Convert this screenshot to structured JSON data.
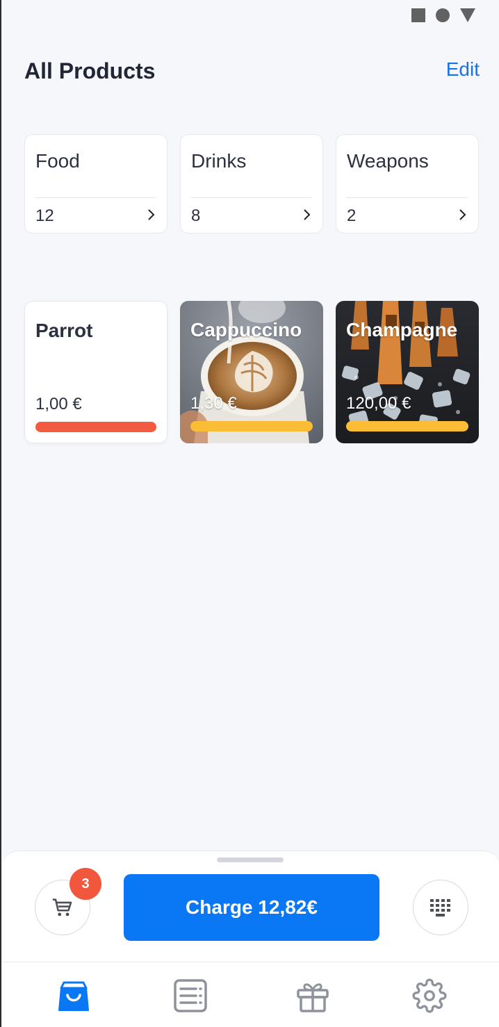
{
  "status_bar": {
    "icons": [
      "square-icon",
      "circle-icon",
      "triangle-icon"
    ]
  },
  "header": {
    "title": "All Products",
    "edit_label": "Edit"
  },
  "categories": [
    {
      "name": "Food",
      "count": "12"
    },
    {
      "name": "Drinks",
      "count": "8"
    },
    {
      "name": "Weapons",
      "count": "2"
    }
  ],
  "products": [
    {
      "name": "Parrot",
      "price": "1,00 €",
      "bar_color": "#f25b3f",
      "image": "none"
    },
    {
      "name": "Cappuccino",
      "price": "1,30 €",
      "bar_color": "#fbbd36",
      "image": "latte-art-photo"
    },
    {
      "name": "Champagne",
      "price": "120,00 €",
      "bar_color": "#fbbd36",
      "image": "champagne-bottles-on-ice-photo"
    }
  ],
  "cart": {
    "badge_count": "3",
    "icon": "cart-icon"
  },
  "charge": {
    "label": "Charge 12,82€"
  },
  "keypad": {
    "icon": "keypad-icon"
  },
  "nav": {
    "items": [
      {
        "name": "shop-bag-icon",
        "active": true
      },
      {
        "name": "receipt-list-icon",
        "active": false
      },
      {
        "name": "gift-icon",
        "active": false
      },
      {
        "name": "settings-gear-icon",
        "active": false
      }
    ]
  },
  "colors": {
    "accent": "#0a78f5",
    "active_icon": "#0a78f5",
    "inactive_icon": "#8d929b",
    "badge": "#f0573c"
  }
}
